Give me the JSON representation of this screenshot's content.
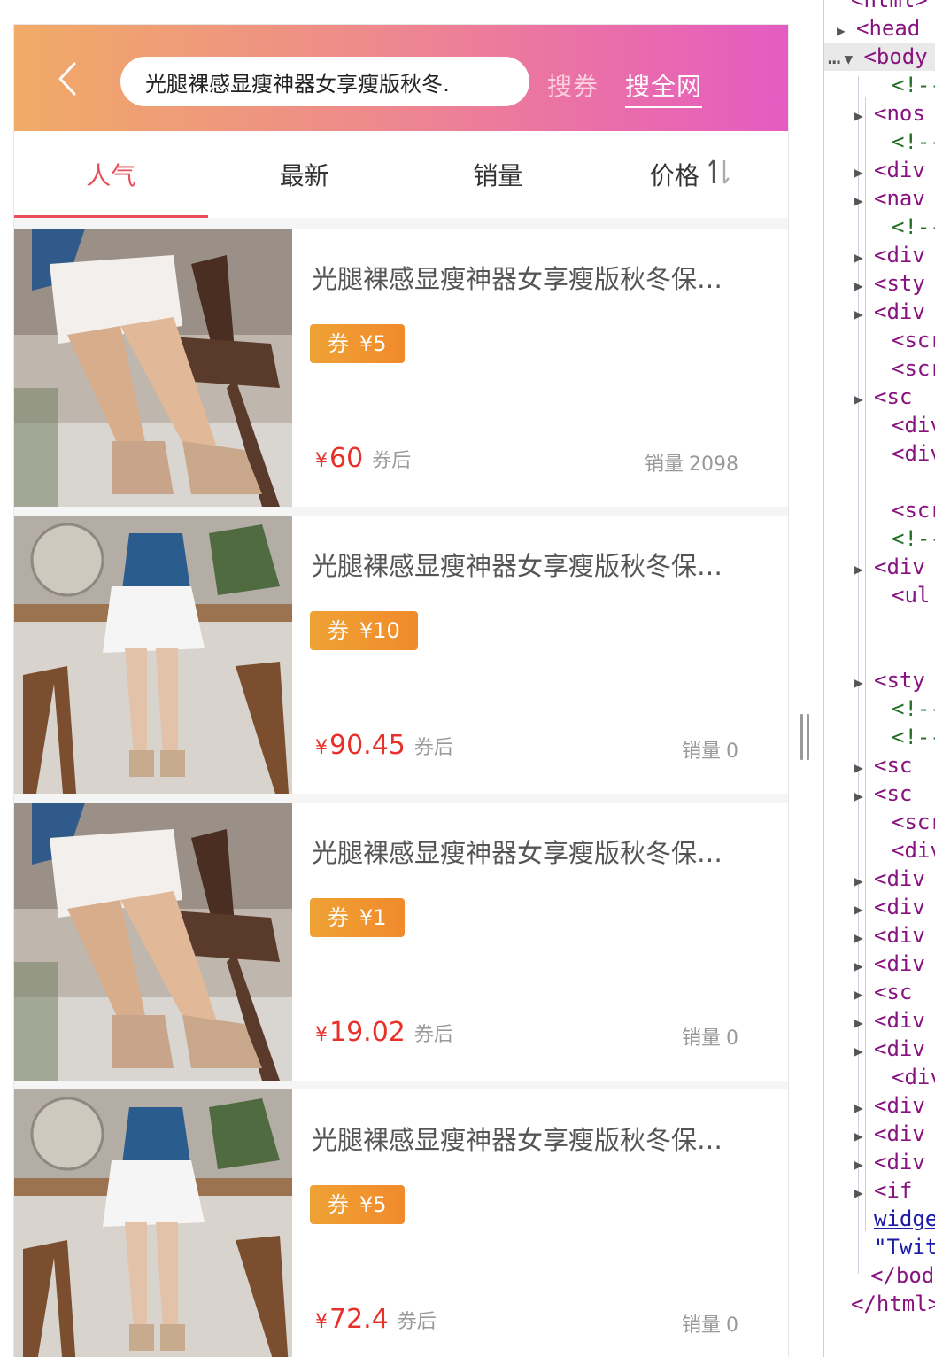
{
  "header": {
    "search_value": "光腿裸感显瘦神器女享瘦版秋冬…",
    "btn_coupon": "搜券",
    "btn_all": "搜全网"
  },
  "tabs": [
    {
      "label": "人气",
      "active": true
    },
    {
      "label": "最新",
      "active": false
    },
    {
      "label": "销量",
      "active": false
    },
    {
      "label": "价格",
      "active": false,
      "icon": "sort-icon"
    }
  ],
  "products": [
    {
      "title": "光腿裸感显瘦神器女享瘦版秋冬保暖连裤袜",
      "coupon_label": "券",
      "coupon_value": "¥5",
      "currency": "¥",
      "price": "60",
      "price_suffix": "券后",
      "sales_label": "销量",
      "sales": "2098",
      "image": "legs-skirt-photo"
    },
    {
      "title": "光腿裸感显瘦神器女享瘦版秋冬保暖连裤袜",
      "coupon_label": "券",
      "coupon_value": "¥10",
      "currency": "¥",
      "price": "90.45",
      "price_suffix": "券后",
      "sales_label": "销量",
      "sales": "0",
      "image": "model-blue-sweater-photo"
    },
    {
      "title": "光腿裸感显瘦神器女享瘦版秋冬保暖连裤袜",
      "coupon_label": "券",
      "coupon_value": "¥1",
      "currency": "¥",
      "price": "19.02",
      "price_suffix": "券后",
      "sales_label": "销量",
      "sales": "0",
      "image": "legs-skirt-photo"
    },
    {
      "title": "光腿裸感显瘦神器女享瘦版秋冬保暖连裤袜",
      "coupon_label": "券",
      "coupon_value": "¥5",
      "currency": "¥",
      "price": "72.4",
      "price_suffix": "券后",
      "sales_label": "销量",
      "sales": "0",
      "image": "model-blue-sweater-photo"
    }
  ],
  "devtools": {
    "lines": [
      {
        "tri": "",
        "text": "<html>",
        "cls": "tag"
      },
      {
        "tri": "▶",
        "text": "<head",
        "cls": "tag"
      },
      {
        "tri": "▼",
        "text": "<body",
        "cls": "tag",
        "prefix": "…"
      },
      {
        "tri": "",
        "text": "<!--",
        "cls": "cmt"
      },
      {
        "tri": "▶",
        "text": "<nos",
        "cls": "tag"
      },
      {
        "tri": "",
        "text": "<!--",
        "cls": "cmt"
      },
      {
        "tri": "▶",
        "text": "<div",
        "cls": "tag"
      },
      {
        "tri": "▶",
        "text": "<nav",
        "cls": "tag"
      },
      {
        "tri": "",
        "text": "<!--",
        "cls": "cmt"
      },
      {
        "tri": "▶",
        "text": "<div",
        "cls": "tag"
      },
      {
        "tri": "▶",
        "text": "<sty",
        "cls": "tag"
      },
      {
        "tri": "▶",
        "text": "<div",
        "cls": "tag"
      },
      {
        "tri": "",
        "text": "<scr",
        "cls": "tag"
      },
      {
        "tri": "",
        "text": "<scr",
        "cls": "tag"
      },
      {
        "tri": "▶",
        "text": "<sc",
        "cls": "tag"
      },
      {
        "tri": "",
        "text": "<div",
        "cls": "tag"
      },
      {
        "tri": "",
        "text": "<div",
        "cls": "tag"
      },
      {
        "tri": "",
        "text": "",
        "cls": "tag"
      },
      {
        "tri": "",
        "text": "<scr",
        "cls": "tag"
      },
      {
        "tri": "",
        "text": "<!--",
        "cls": "cmt"
      },
      {
        "tri": "▶",
        "text": "<div",
        "cls": "tag"
      },
      {
        "tri": "",
        "text": "<ul",
        "cls": "tag"
      },
      {
        "tri": "",
        "text": "",
        "cls": "tag"
      },
      {
        "tri": "",
        "text": "",
        "cls": "tag"
      },
      {
        "tri": "▶",
        "text": "<sty",
        "cls": "tag"
      },
      {
        "tri": "",
        "text": "<!--",
        "cls": "cmt"
      },
      {
        "tri": "",
        "text": "<!--",
        "cls": "cmt"
      },
      {
        "tri": "▶",
        "text": "<sc",
        "cls": "tag"
      },
      {
        "tri": "▶",
        "text": "<sc",
        "cls": "tag"
      },
      {
        "tri": "",
        "text": "<scr",
        "cls": "tag"
      },
      {
        "tri": "",
        "text": "<div",
        "cls": "tag"
      },
      {
        "tri": "▶",
        "text": "<div",
        "cls": "tag"
      },
      {
        "tri": "▶",
        "text": "<div",
        "cls": "tag"
      },
      {
        "tri": "▶",
        "text": "<div",
        "cls": "tag"
      },
      {
        "tri": "▶",
        "text": "<div",
        "cls": "tag"
      },
      {
        "tri": "▶",
        "text": "<sc",
        "cls": "tag"
      },
      {
        "tri": "▶",
        "text": "<div",
        "cls": "tag"
      },
      {
        "tri": "▶",
        "text": "<div",
        "cls": "tag"
      },
      {
        "tri": "",
        "text": "<div",
        "cls": "tag"
      },
      {
        "tri": "▶",
        "text": "<div",
        "cls": "tag"
      },
      {
        "tri": "▶",
        "text": "<div",
        "cls": "tag"
      },
      {
        "tri": "▶",
        "text": "<div",
        "cls": "tag"
      },
      {
        "tri": "▶",
        "text": "<if",
        "cls": "tag"
      },
      {
        "tri": "",
        "text": "widge",
        "cls": "lnk"
      },
      {
        "tri": "",
        "text": "\"Twit",
        "cls": "str"
      },
      {
        "tri": "",
        "text": "</bod",
        "cls": "tag"
      },
      {
        "tri": "",
        "text": "</html>",
        "cls": "tag"
      }
    ]
  }
}
